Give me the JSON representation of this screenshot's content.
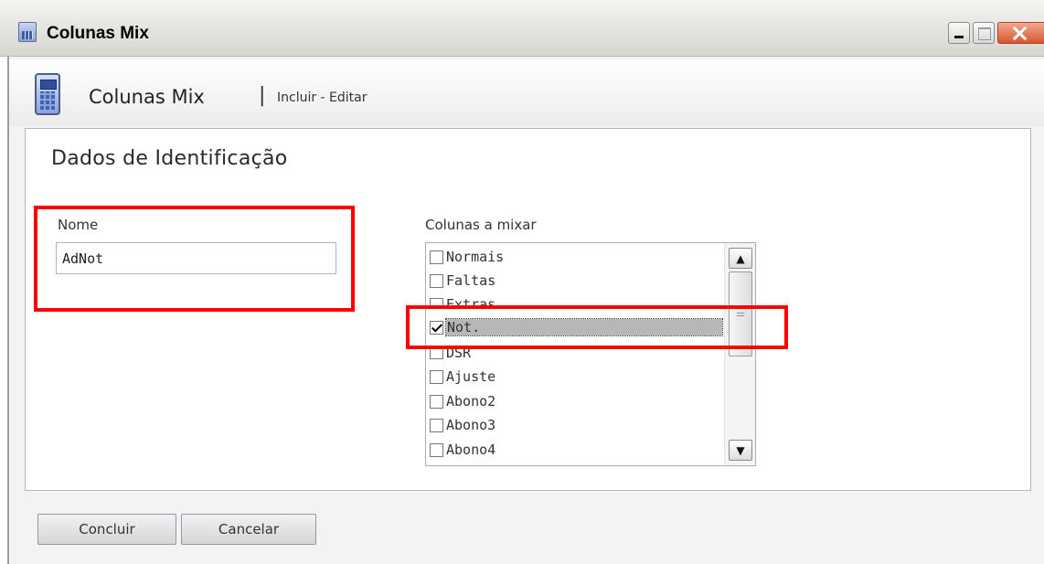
{
  "window": {
    "title": "Colunas Mix"
  },
  "header": {
    "title": "Colunas Mix",
    "separator": "|",
    "subtitle": "Incluir - Editar"
  },
  "section": {
    "title": "Dados de Identificação"
  },
  "nome": {
    "label": "Nome",
    "value": "AdNot"
  },
  "colunas": {
    "label": "Colunas a mixar",
    "items": [
      {
        "label": "Normais",
        "checked": false
      },
      {
        "label": "Faltas",
        "checked": false
      },
      {
        "label": "Extras",
        "checked": false
      },
      {
        "label": "Not.",
        "checked": true,
        "selected": true
      },
      {
        "label": "DSR",
        "checked": false
      },
      {
        "label": "Ajuste",
        "checked": false
      },
      {
        "label": "Abono2",
        "checked": false
      },
      {
        "label": "Abono3",
        "checked": false
      },
      {
        "label": "Abono4",
        "checked": false
      }
    ],
    "scroll_up_glyph": "▲",
    "scroll_down_glyph": "▼"
  },
  "buttons": {
    "concluir": "Concluir",
    "cancelar": "Cancelar"
  },
  "colors": {
    "highlight": "#ff0000",
    "selection": "#b7b7b7",
    "panel_border": "#a9b8cb"
  },
  "icons": {
    "window": "calculator-icon",
    "app": "calculator-icon",
    "minimize": "minimize-icon",
    "maximize": "maximize-icon",
    "close": "close-icon"
  }
}
